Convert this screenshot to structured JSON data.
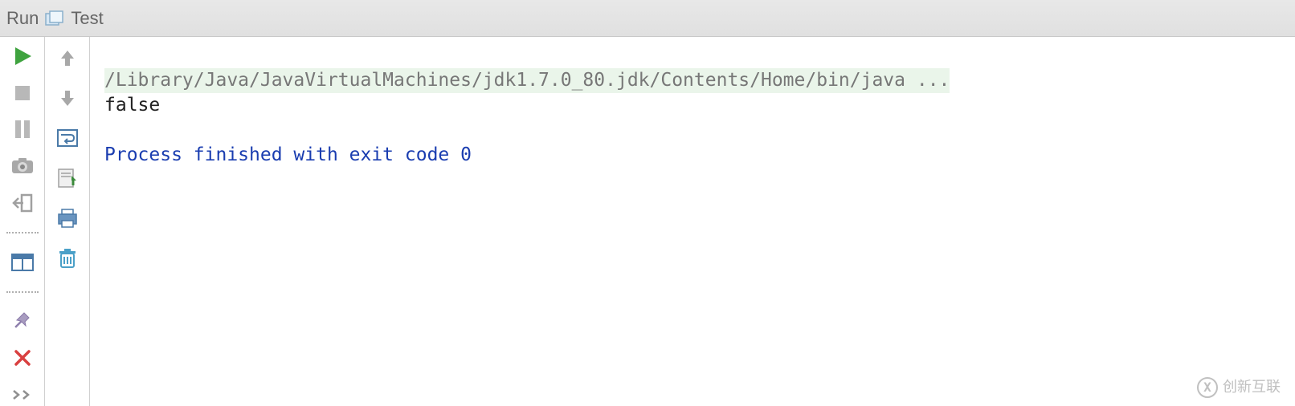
{
  "header": {
    "panel_label": "Run",
    "run_config_name": "Test"
  },
  "toolbar_left": {
    "run": "run-icon",
    "stop": "stop-icon",
    "pause": "pause-icon",
    "camera": "camera-icon",
    "exit": "exit-icon",
    "layout": "layout-icon",
    "pin": "pin-icon",
    "close": "close-icon",
    "more": "more-icon"
  },
  "toolbar_right": {
    "up": "arrow-up-icon",
    "down": "arrow-down-icon",
    "wrap": "wrap-icon",
    "scroll": "scroll-icon",
    "print": "print-icon",
    "trash": "trash-icon"
  },
  "console": {
    "command_line": "/Library/Java/JavaVirtualMachines/jdk1.7.0_80.jdk/Contents/Home/bin/java ...",
    "output_line": "false",
    "exit_line": "Process finished with exit code 0"
  },
  "watermark": {
    "text": "创新互联"
  }
}
